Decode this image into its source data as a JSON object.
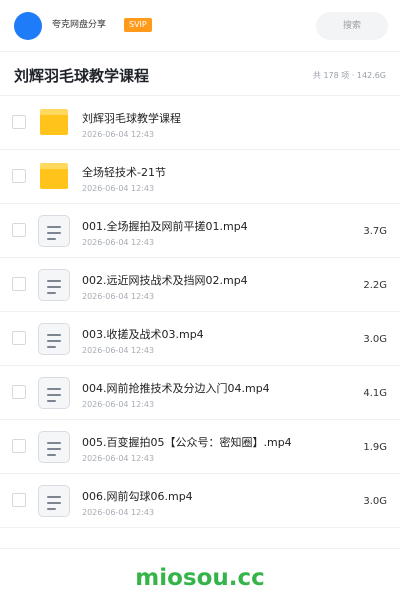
{
  "header": {
    "user_name": "夸克网盘分享",
    "vip_badge": "SVIP",
    "search_label": "搜索",
    "avatar_color": "#1f7cf8"
  },
  "title_bar": {
    "title": "刘辉羽毛球教学课程",
    "summary": "共 178 项 · 142.6G"
  },
  "files": [
    {
      "name": "刘辉羽毛球教学课程",
      "date": "2026-06-04 12:43",
      "size": "",
      "type": "folder",
      "icon": "folder-icon"
    },
    {
      "name": "全场轻技术-21节",
      "date": "2026-06-04 12:43",
      "size": "",
      "type": "folder",
      "icon": "folder-icon"
    },
    {
      "name": "001.全场握拍及网前平搓01.mp4",
      "date": "2026-06-04 12:43",
      "size": "3.7G",
      "type": "file",
      "icon": "document-icon"
    },
    {
      "name": "002.远近网技战术及挡网02.mp4",
      "date": "2026-06-04 12:43",
      "size": "2.2G",
      "type": "file",
      "icon": "document-icon"
    },
    {
      "name": "003.收搓及战术03.mp4",
      "date": "2026-06-04 12:43",
      "size": "3.0G",
      "type": "file",
      "icon": "document-icon"
    },
    {
      "name": "004.网前抢推技术及分边入门04.mp4",
      "date": "2026-06-04 12:43",
      "size": "4.1G",
      "type": "file",
      "icon": "document-icon"
    },
    {
      "name": "005.百变握拍05【公众号：密知圈】.mp4",
      "date": "2026-06-04 12:43",
      "size": "1.9G",
      "type": "file",
      "icon": "document-icon"
    },
    {
      "name": "006.网前勾球06.mp4",
      "date": "2026-06-04 12:43",
      "size": "3.0G",
      "type": "file",
      "icon": "document-icon"
    }
  ],
  "footer": {
    "brand": "miosou.cc",
    "brand_color": "#35b44a"
  },
  "colors": {
    "accent": "#1f7cf8",
    "vip": "#ff9a1a",
    "folder": "#ffc31a"
  }
}
